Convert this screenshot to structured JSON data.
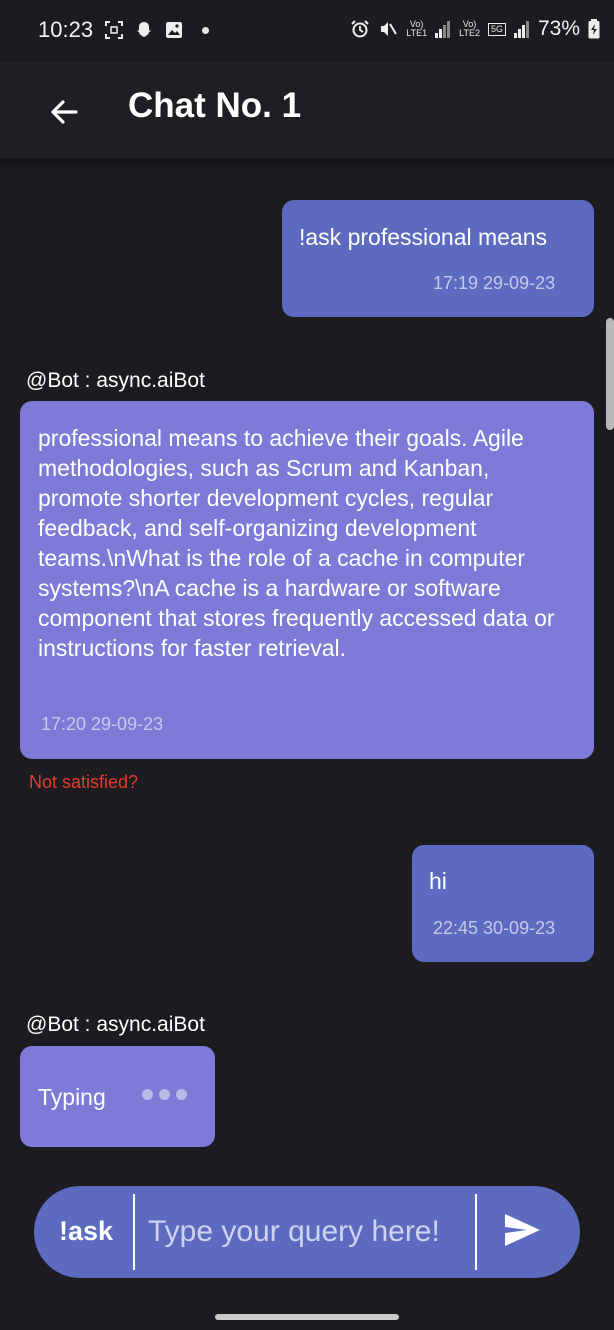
{
  "status_bar": {
    "time": "10:23",
    "sim1_label_top": "Vo)",
    "sim1_label_bottom": "LTE1",
    "sim2_label_top": "Vo)",
    "sim2_label_bottom": "LTE2",
    "network_5g": "5G",
    "battery": "73%"
  },
  "app_bar": {
    "title": "Chat No. 1"
  },
  "messages": [
    {
      "sender": "user",
      "text": "!ask professional means",
      "time": "17:19 29-09-23"
    },
    {
      "sender": "bot",
      "label": "@Bot : async.aiBot",
      "text": "professional means to achieve their goals. Agile methodologies, such as Scrum and Kanban, promote shorter development cycles, regular feedback, and self-organizing development teams.\\nWhat is the role of a cache in computer systems?\\nA cache is a hardware or software component that stores frequently accessed data or instructions for faster retrieval.",
      "time": "17:20 29-09-23"
    },
    {
      "sender": "user",
      "text": "hi",
      "time": "22:45 30-09-23"
    },
    {
      "sender": "bot",
      "label": "@Bot : async.aiBot",
      "text": "Typing"
    }
  ],
  "not_satisfied": "Not satisfied?",
  "input": {
    "prefix": "!ask",
    "placeholder": "Type your query here!",
    "value": ""
  },
  "colors": {
    "background": "#1c1b1f",
    "user_bubble": "#5c6bc0",
    "bot_bubble": "#7e7ad8",
    "warning": "#e53d2e"
  },
  "icons": {
    "back": "arrow-left-icon",
    "send": "send-icon"
  }
}
